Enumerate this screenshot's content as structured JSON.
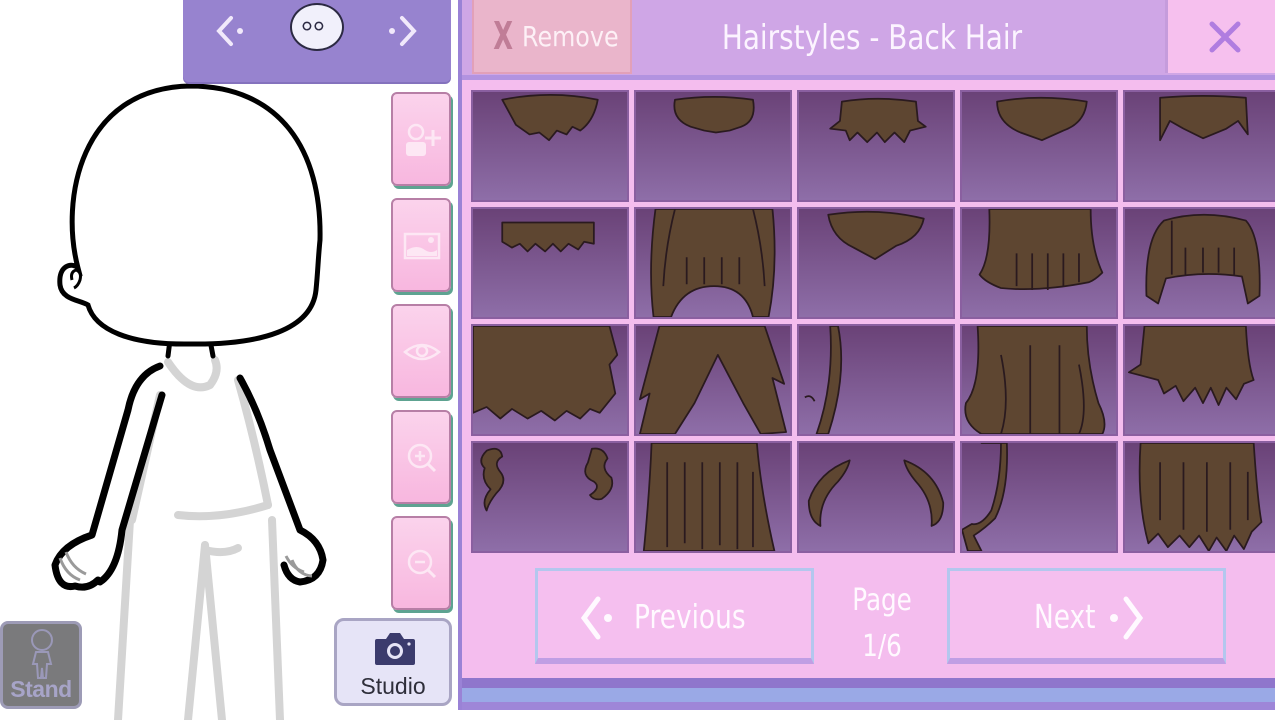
{
  "character_nav": {
    "prev_icon": "chevron-left-icon",
    "next_icon": "chevron-right-icon",
    "face_icon": "character-face-icon"
  },
  "side_tools": [
    {
      "name": "add-character",
      "icon": "add-person-icon"
    },
    {
      "name": "background",
      "icon": "image-icon"
    },
    {
      "name": "visibility",
      "icon": "eye-icon"
    },
    {
      "name": "zoom-in",
      "icon": "zoom-in-icon"
    },
    {
      "name": "zoom-out",
      "icon": "zoom-out-icon"
    }
  ],
  "studio_button": {
    "label": "Studio",
    "icon": "camera-icon"
  },
  "stand_button": {
    "label": "Stand",
    "icon": "standing-figure-icon"
  },
  "panel": {
    "title": "Hairstyles - Back Hair",
    "remove_label": "Remove",
    "remove_icon_glyph": "X",
    "close_icon": "close-icon"
  },
  "items": [
    {
      "id": 1,
      "style": "short-spiky-tuft"
    },
    {
      "id": 2,
      "style": "short-rounded-tuft"
    },
    {
      "id": 3,
      "style": "spiky-tuft"
    },
    {
      "id": 4,
      "style": "rounded-point"
    },
    {
      "id": 5,
      "style": "tuft-with-sidelocks"
    },
    {
      "id": 6,
      "style": "zigzag-strip"
    },
    {
      "id": 7,
      "style": "long-straight-bangs"
    },
    {
      "id": 8,
      "style": "triangular-point"
    },
    {
      "id": 9,
      "style": "medium-straight"
    },
    {
      "id": 10,
      "style": "bob-with-fringe"
    },
    {
      "id": 11,
      "style": "messy-long"
    },
    {
      "id": 12,
      "style": "split-long"
    },
    {
      "id": 13,
      "style": "single-side-lock"
    },
    {
      "id": 14,
      "style": "long-wavy"
    },
    {
      "id": 15,
      "style": "medium-shaggy"
    },
    {
      "id": 16,
      "style": "twin-curls"
    },
    {
      "id": 17,
      "style": "long-straight"
    },
    {
      "id": 18,
      "style": "curved-sidelocks"
    },
    {
      "id": 19,
      "style": "side-ponytail"
    },
    {
      "id": 20,
      "style": "long-layered"
    }
  ],
  "pagination": {
    "previous_label": "Previous",
    "next_label": "Next",
    "page_label": "Page",
    "current_page": 1,
    "total_pages": 6,
    "page_text": "1/6"
  },
  "colors": {
    "hair_fill": "#5e4631",
    "hair_stroke": "#2a1a1f",
    "cell_top": "#6a4277",
    "cell_bottom": "#8e6ea8",
    "panel_bg": "#f4bdee",
    "header_bg": "#cfa6e6",
    "nav_bg": "#9783cf"
  }
}
